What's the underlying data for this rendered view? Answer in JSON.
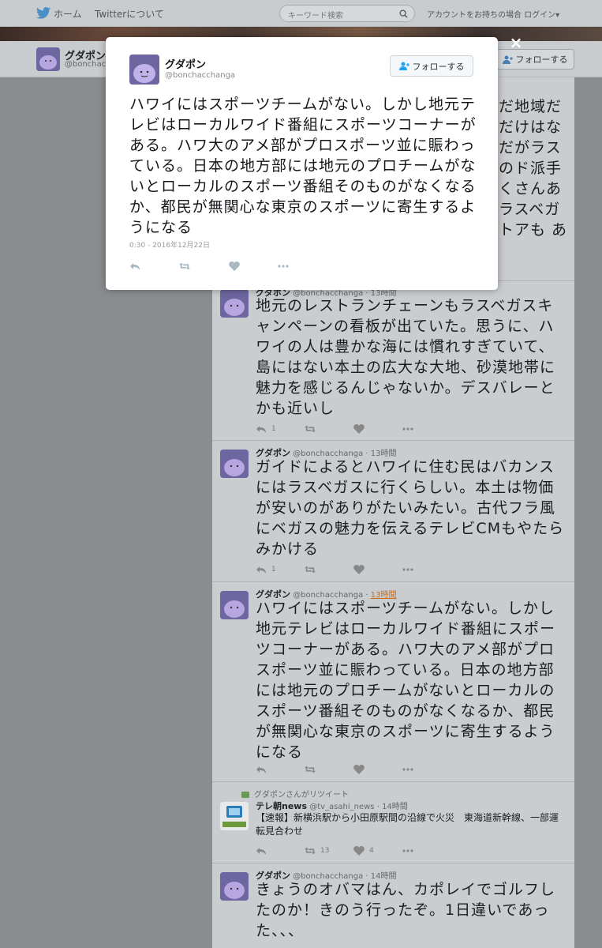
{
  "topnav": {
    "home_label": "ホーム",
    "about_label": "Twitterについて",
    "search_placeholder": "キーワード検索",
    "login_label": "アカウントをお持ちの場合 ログイン▾"
  },
  "profile": {
    "name": "グダポン",
    "handle": "@bonchacc",
    "follow_label": "フォローする"
  },
  "modal": {
    "name": "グダポン",
    "handle": "@bonchacchanga",
    "follow_label": "フォローする",
    "text": "ハワイにはスポーツチームがない。しかし地元テレビはローカルワイド番組にスポーツコーナーがある。ハワ大のアメ部がプロスポーツ並に賑わっている。日本の地方部には地元のプロチームがないとローカルのスポーツ番組そのものがなくなるか、都民が無関心な東京のスポーツに寄生するようになる",
    "timestamp": "0:30 - 2016年12月22日",
    "close_label": "×"
  },
  "timeline": {
    "partial_texts": [
      "だ地域だ",
      "だけはな",
      "だがラス",
      "のド派手",
      "くさんあ",
      "ラスベガ",
      "トアも あ"
    ],
    "tweets": [
      {
        "name": "グダポン",
        "handle": "@bonchacchanga",
        "time": "13時間",
        "text": "地元のレストランチェーンもラスベガスキャンペーンの看板が出ていた。思うに、ハワイの人は豊かな海には慣れすぎていて、島にはない本土の広大な大地、砂漠地帯に魅力を感じるんじゃないか。デスバレーとかも近いし",
        "reply_count": "1",
        "retweet_count": "",
        "like_count": ""
      },
      {
        "name": "グダポン",
        "handle": "@bonchacchanga",
        "time": "13時間",
        "text": "ガイドによるとハワイに住む民はバカンスにはラスベガスに行くらしい。本土は物価が安いのがありがたいみたい。古代フラ風にベガスの魅力を伝えるテレビCMもやたらみかける",
        "reply_count": "1",
        "retweet_count": "",
        "like_count": ""
      },
      {
        "name": "グダポン",
        "handle": "@bonchacchanga",
        "time": "13時間",
        "text": "ハワイにはスポーツチームがない。しかし地元テレビはローカルワイド番組にスポーツコーナーがある。ハワ大のアメ部がプロスポーツ並に賑わっている。日本の地方部には地元のプロチームがないとローカルのスポーツ番組そのものがなくなるか、都民が無関心な東京のスポーツに寄生するようになる",
        "reply_count": "",
        "retweet_count": "",
        "like_count": ""
      },
      {
        "retweet_label": "グダポンさんがリツイート",
        "name": "テレ朝news",
        "handle": "@tv_asahi_news",
        "time": "14時間",
        "text": "【速報】新横浜駅から小田原駅間の沿線で火災　東海道新幹線、一部運転見合わせ",
        "reply_count": "",
        "retweet_count": "13",
        "like_count": "4",
        "avatar_text": "テレ朝news"
      },
      {
        "name": "グダポン",
        "handle": "@bonchacchanga",
        "time": "14時間",
        "text": "きょうのオバマはん、カポレイでゴルフしたのか！きのう行ったぞ。1日違いであった、、、",
        "reply_count": "",
        "retweet_count": "",
        "like_count": ""
      }
    ]
  },
  "colors": {
    "modal_bg": "#ffffff",
    "overlay_bg": "#8a8d90",
    "highlight_time": "#c96a18"
  },
  "icons": [
    "twitter-bird-icon",
    "search-icon",
    "follow-person-icon",
    "reply-icon",
    "retweet-icon",
    "like-icon",
    "more-icon",
    "close-icon"
  ]
}
